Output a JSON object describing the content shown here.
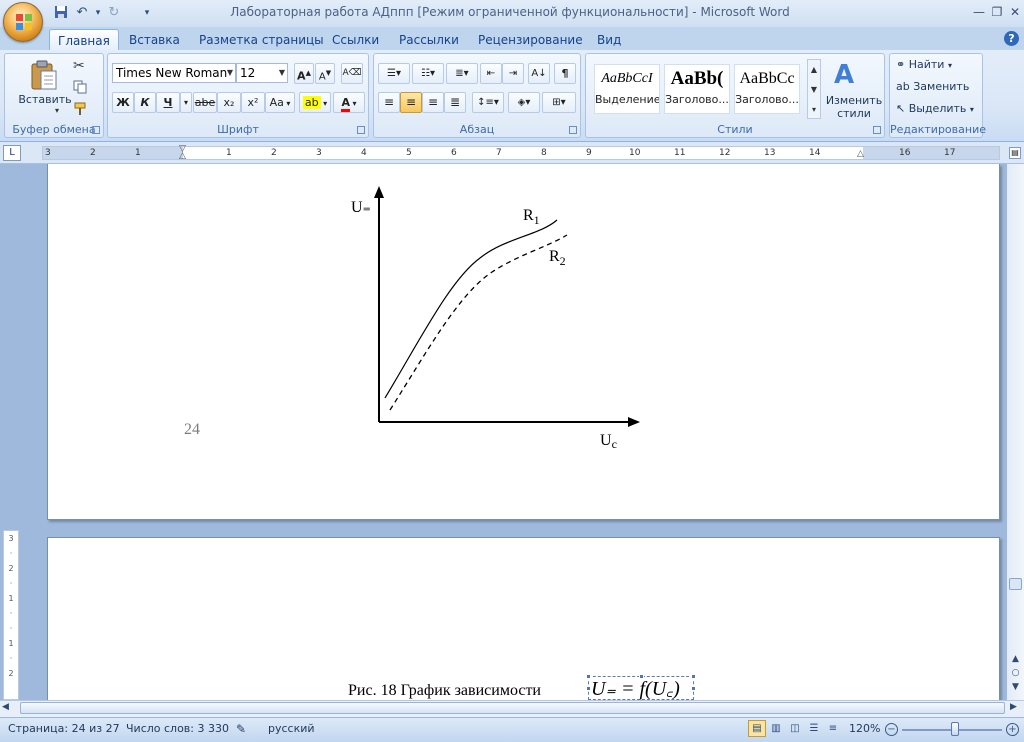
{
  "window": {
    "title": "Лабораторная работа АДппп [Режим ограниченной функциональности] - Microsoft Word",
    "minimize_icon": "minimize-icon",
    "maximize_icon": "restore-icon",
    "close_icon": "close-icon"
  },
  "quick_access": [
    "save-icon",
    "undo-icon",
    "redo-icon",
    "customize-icon"
  ],
  "tabs": [
    "Главная",
    "Вставка",
    "Разметка страницы",
    "Ссылки",
    "Рассылки",
    "Рецензирование",
    "Вид"
  ],
  "ribbon": {
    "clipboard": {
      "name": "Буфер обмена",
      "paste_label": "Вставить"
    },
    "font": {
      "name": "Шрифт",
      "font_name": "Times New Roman",
      "font_size": "12",
      "bold": "Ж",
      "italic": "К",
      "underline": "Ч",
      "strike": "abe",
      "subscript": "x₂",
      "superscript": "x²",
      "change_case": "Aa",
      "grow": "A",
      "shrink": "A",
      "highlight": "ab",
      "font_color": "A"
    },
    "paragraph": {
      "name": "Абзац"
    },
    "styles": {
      "name": "Стили",
      "items": [
        {
          "preview": "AaBbCcI",
          "label": "Выделение"
        },
        {
          "preview": "AaBb(",
          "label": "Заголово..."
        },
        {
          "preview": "AaBbCc",
          "label": "Заголово..."
        }
      ],
      "change_styles": "Изменить стили"
    },
    "editing": {
      "name": "Редактирование",
      "find": "Найти",
      "replace": "Заменить",
      "select": "Выделить"
    }
  },
  "ruler": {
    "ticks_left": [
      "3",
      "2",
      "1"
    ],
    "ticks_right": [
      "1",
      "2",
      "3",
      "4",
      "5",
      "6",
      "7",
      "8",
      "9",
      "10",
      "11",
      "12",
      "13",
      "14",
      "15",
      "16",
      "17"
    ]
  },
  "document": {
    "page_number": "24",
    "caption": "Рис. 18 График зависимости",
    "equation": "U₌ = f(U꜀)",
    "graph": {
      "y_label": "U₌",
      "x_label": "U",
      "x_label_sub": "c",
      "r1_label": "R",
      "r1_sub": "1",
      "r2_label": "R",
      "r2_sub": "2"
    }
  },
  "status": {
    "page": "Страница: 24 из 27",
    "words": "Число слов: 3 330",
    "language": "русский",
    "zoom": "120%",
    "zoom_level": 120
  },
  "colors": {
    "ribbon_text": "#15428b",
    "highlight": "#ffff00",
    "font_color": "#ff0000"
  }
}
